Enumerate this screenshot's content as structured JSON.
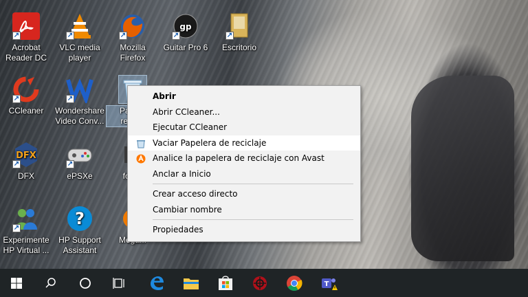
{
  "desktop": {
    "icons": [
      {
        "label": "Acrobat Reader DC",
        "icon": "acrobat-icon",
        "color": "#d7261e"
      },
      {
        "label": "VLC media player",
        "icon": "vlc-icon",
        "color": "#f08a00"
      },
      {
        "label": "Mozilla Firefox",
        "icon": "firefox-icon",
        "color": "#e66000"
      },
      {
        "label": "Guitar Pro 6",
        "icon": "guitar-pro-icon",
        "color": "#222222"
      },
      {
        "label": "Escritorio",
        "icon": "folder-icon",
        "color": "#d9b45a"
      },
      {
        "label": "CCleaner",
        "icon": "ccleaner-icon",
        "color": "#e03a1e"
      },
      {
        "label": "Wondershare Video Conv...",
        "icon": "wondershare-icon",
        "color": "#1e5fc9"
      },
      {
        "label": "Pape... recic...",
        "icon": "recycle-bin-icon",
        "color": "#9ec7e8"
      },
      {
        "label": "DFX",
        "icon": "dfx-icon",
        "color": "#3c6ea8"
      },
      {
        "label": "ePSXe",
        "icon": "epsxe-icon",
        "color": "#cfcfcf"
      },
      {
        "label": "focus",
        "icon": "focus-icon",
        "color": "#333333"
      },
      {
        "label": "Experimente HP Virtual ...",
        "icon": "hp-virtual-icon",
        "color": "#2a7ad6"
      },
      {
        "label": "HP Support Assistant",
        "icon": "hp-support-icon",
        "color": "#0a8bd6"
      },
      {
        "label": "Mega...",
        "icon": "mega-icon",
        "color": "#f07b00"
      }
    ]
  },
  "context_menu": {
    "items": [
      {
        "label": "Abrir",
        "bold": true
      },
      {
        "label": "Abrir CCleaner..."
      },
      {
        "label": "Ejecutar CCleaner"
      },
      {
        "label": "Vaciar Papelera de reciclaje",
        "icon": "recycle-bin-icon",
        "hover": true
      },
      {
        "label": "Analice la papelera de reciclaje con Avast",
        "icon": "avast-icon"
      },
      {
        "label": "Anclar a Inicio"
      },
      {
        "label": "Crear acceso directo"
      },
      {
        "label": "Cambiar nombre"
      },
      {
        "label": "Propiedades"
      }
    ]
  },
  "taskbar": {
    "items": [
      "windows-start-icon",
      "search-icon",
      "cortana-icon",
      "task-view-icon",
      "edge-icon",
      "file-explorer-icon",
      "store-icon",
      "app-red-icon",
      "chrome-icon",
      "teams-icon"
    ]
  }
}
